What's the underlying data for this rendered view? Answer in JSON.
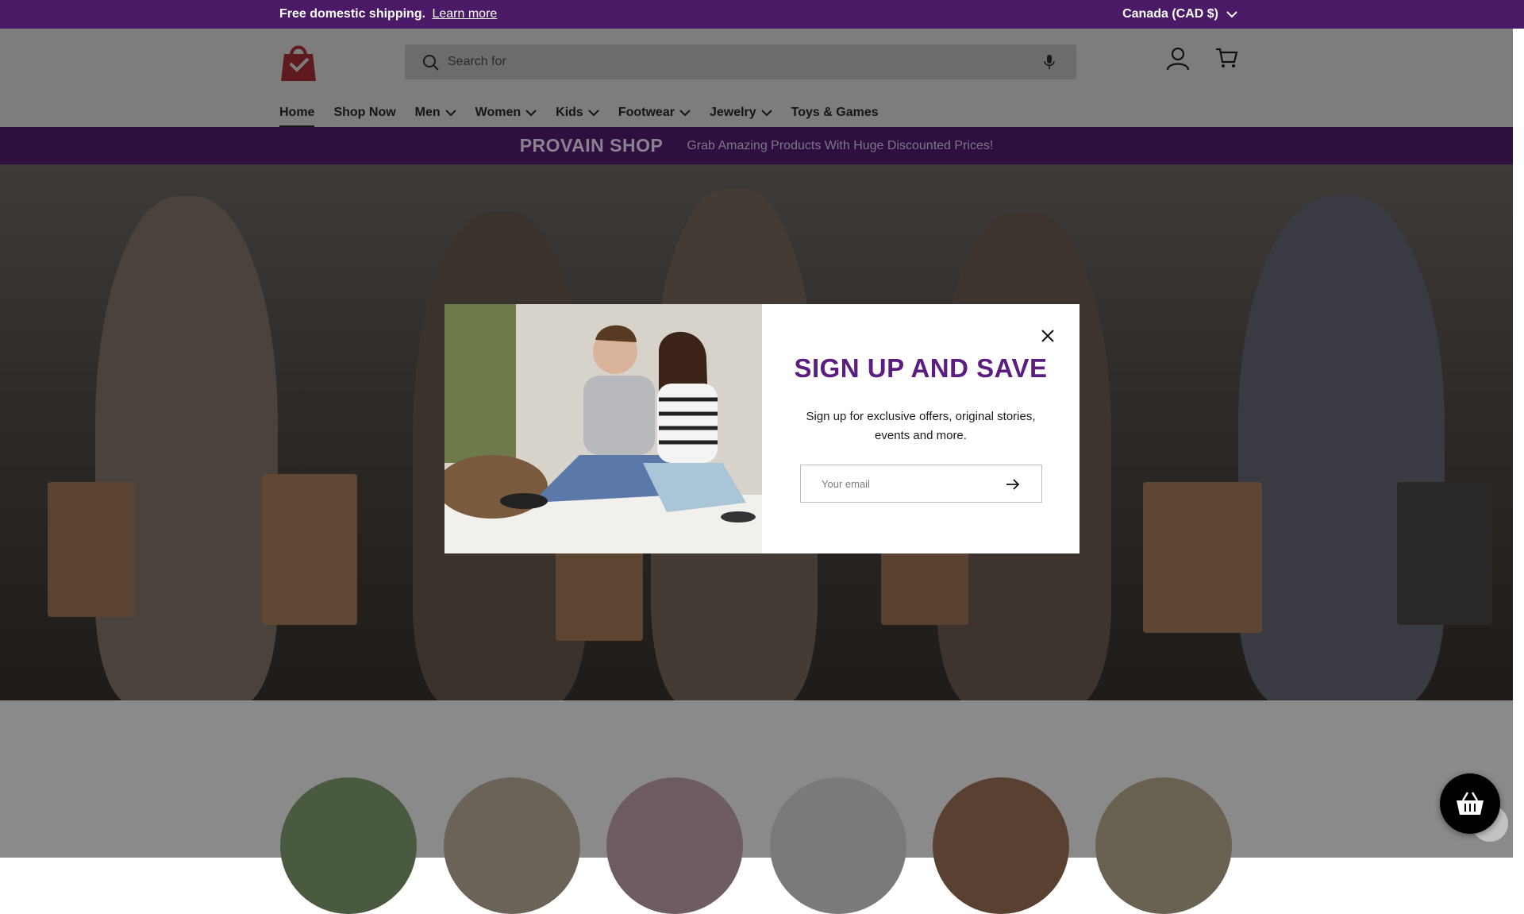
{
  "announcement": {
    "shipping_text": "Free domestic shipping.",
    "learn_more": "Learn more",
    "region": "Canada (CAD $)"
  },
  "header": {
    "search_placeholder": "Search for",
    "nav": [
      {
        "label": "Home",
        "active": true
      },
      {
        "label": "Shop Now"
      },
      {
        "label": "Men",
        "dropdown": true
      },
      {
        "label": "Women",
        "dropdown": true
      },
      {
        "label": "Kids",
        "dropdown": true
      },
      {
        "label": "Footwear",
        "dropdown": true
      },
      {
        "label": "Jewelry",
        "dropdown": true
      },
      {
        "label": "Toys & Games"
      }
    ]
  },
  "promo": {
    "brand": "PROVAIN SHOP",
    "tagline": "Grab Amazing Products With Huge Discounted Prices!"
  },
  "modal": {
    "title": "SIGN UP AND SAVE",
    "description": "Sign up for exclusive offers, original stories, events and more.",
    "email_placeholder": "Your email"
  },
  "colors": {
    "announcement_bg": "#4a1a66",
    "accent": "#5c1d80",
    "promo_bg": "#2f0f40"
  }
}
